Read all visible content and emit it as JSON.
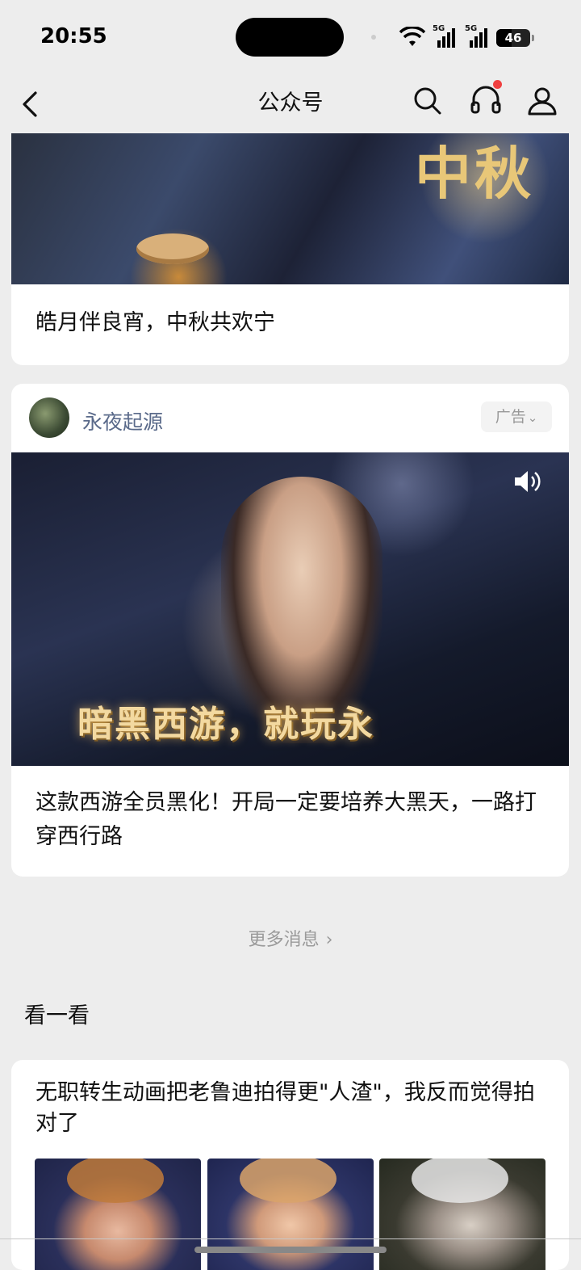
{
  "status_bar": {
    "time": "20:55",
    "network_1": "5G",
    "network_2": "5G",
    "battery_level": "46",
    "battery_percent": 46
  },
  "nav": {
    "title": "公众号",
    "icons": [
      "chevron-left-icon",
      "search-icon",
      "headphones-icon",
      "profile-icon"
    ],
    "audio_badge_color": "#f04040"
  },
  "feed": {
    "card1": {
      "title": "皓月伴良宵，中秋共欢宁",
      "banner_text": "中秋"
    },
    "ad_card": {
      "account_name": "永夜起源",
      "ad_label": "广告",
      "video_slogan": "暗黑西游，就玩永",
      "title": "这款西游全员黑化！开局一定要培养大黑天，一路打穿西行路"
    }
  },
  "more_messages": "更多消息",
  "kanyikan": {
    "section_title": "看一看",
    "article_title": "无职转生动画把老鲁迪拍得更\"人渣\"，我反而觉得拍对了"
  },
  "colors": {
    "background": "#ededed",
    "card": "#ffffff",
    "account_name": "#5a6a8a",
    "muted": "#9a9a9a"
  }
}
